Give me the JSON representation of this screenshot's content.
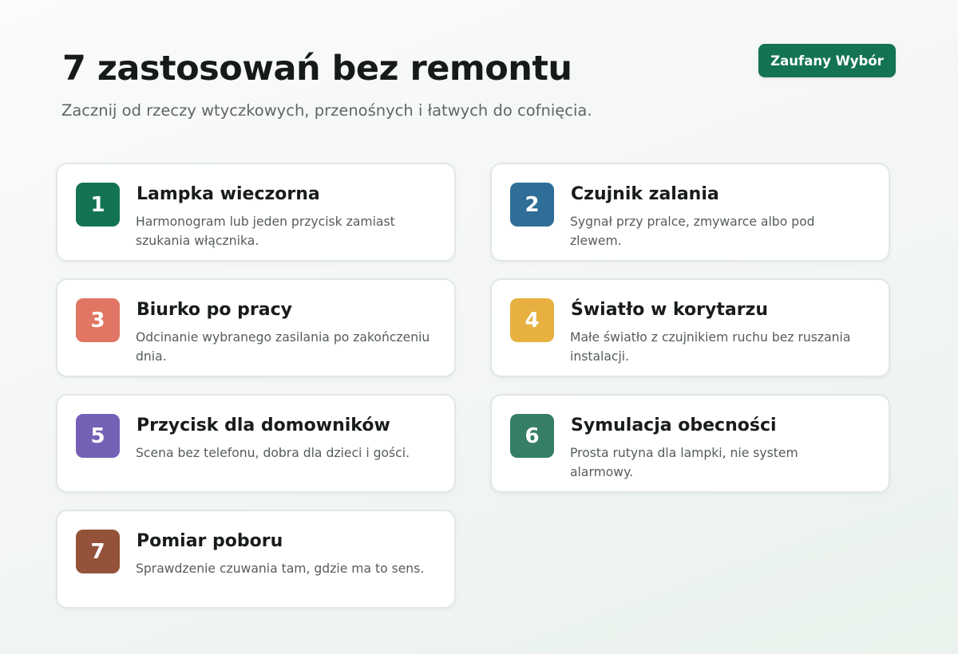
{
  "header": {
    "title": "7 zastosowań bez remontu",
    "subtitle": "Zacznij od rzeczy wtyczkowych, przenośnych i łatwych do cofnięcia.",
    "brand_button": "Zaufany Wybór"
  },
  "colors": {
    "brand": "#147452"
  },
  "items": [
    {
      "number": "1",
      "title": "Lampka wieczorna",
      "description": "Harmonogram lub jeden przycisk zamiast szukania włącznika.",
      "color": "#147452"
    },
    {
      "number": "2",
      "title": "Czujnik zalania",
      "description": "Sygnał przy pralce, zmywarce albo pod zlewem.",
      "color": "#2e6e97"
    },
    {
      "number": "3",
      "title": "Biurko po pracy",
      "description": "Odcinanie wybranego zasilania po zakończeniu dnia.",
      "color": "#e07663"
    },
    {
      "number": "4",
      "title": "Światło w korytarzu",
      "description": "Małe światło z czujnikiem ruchu bez ruszania instalacji.",
      "color": "#e7b040"
    },
    {
      "number": "5",
      "title": "Przycisk dla domowników",
      "description": "Scena bez telefonu, dobra dla dzieci i gości.",
      "color": "#7461b6"
    },
    {
      "number": "6",
      "title": "Symulacja obecności",
      "description": "Prosta rutyna dla lampki, nie system alarmowy.",
      "color": "#367f65"
    },
    {
      "number": "7",
      "title": "Pomiar poboru",
      "description": "Sprawdzenie czuwania tam, gdzie ma to sens.",
      "color": "#94523a"
    }
  ]
}
